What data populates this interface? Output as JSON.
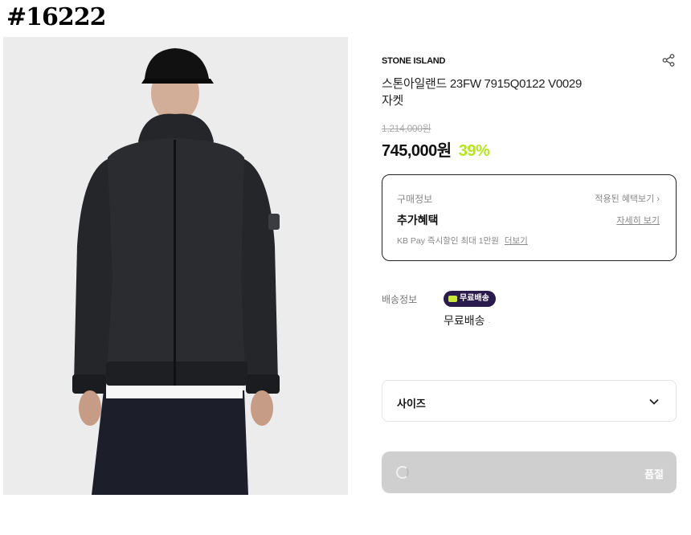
{
  "item_code": "#16222",
  "product": {
    "brand": "STONE ISLAND",
    "name_line1": "스톤아일랜드 23FW 7915Q0122 V0029",
    "name_line2": "자켓",
    "original_price": "1,214,000원",
    "sale_price": "745,000원",
    "discount": "39%"
  },
  "purchase_info": {
    "label": "구매정보",
    "applied_benefits": "적용된 혜택보기 ›",
    "title": "추가혜택",
    "detail_link": "자세히 보기",
    "kb_pay": "KB Pay 즉시할인 최대 1만원",
    "more_link": "더보기"
  },
  "shipping": {
    "label": "배송정보",
    "badge": "무료배송",
    "text": "무료배송",
    "dot": "·"
  },
  "size": {
    "label": "사이즈"
  },
  "buy_button": {
    "label": "품절"
  },
  "icons": {
    "share": "share-icon",
    "chevron": "chevron-down-icon",
    "truck": "truck-icon"
  },
  "colors": {
    "discount": "#b5e61d",
    "badge_bg": "#2a1b4d",
    "button_disabled": "#cfcfcf"
  }
}
